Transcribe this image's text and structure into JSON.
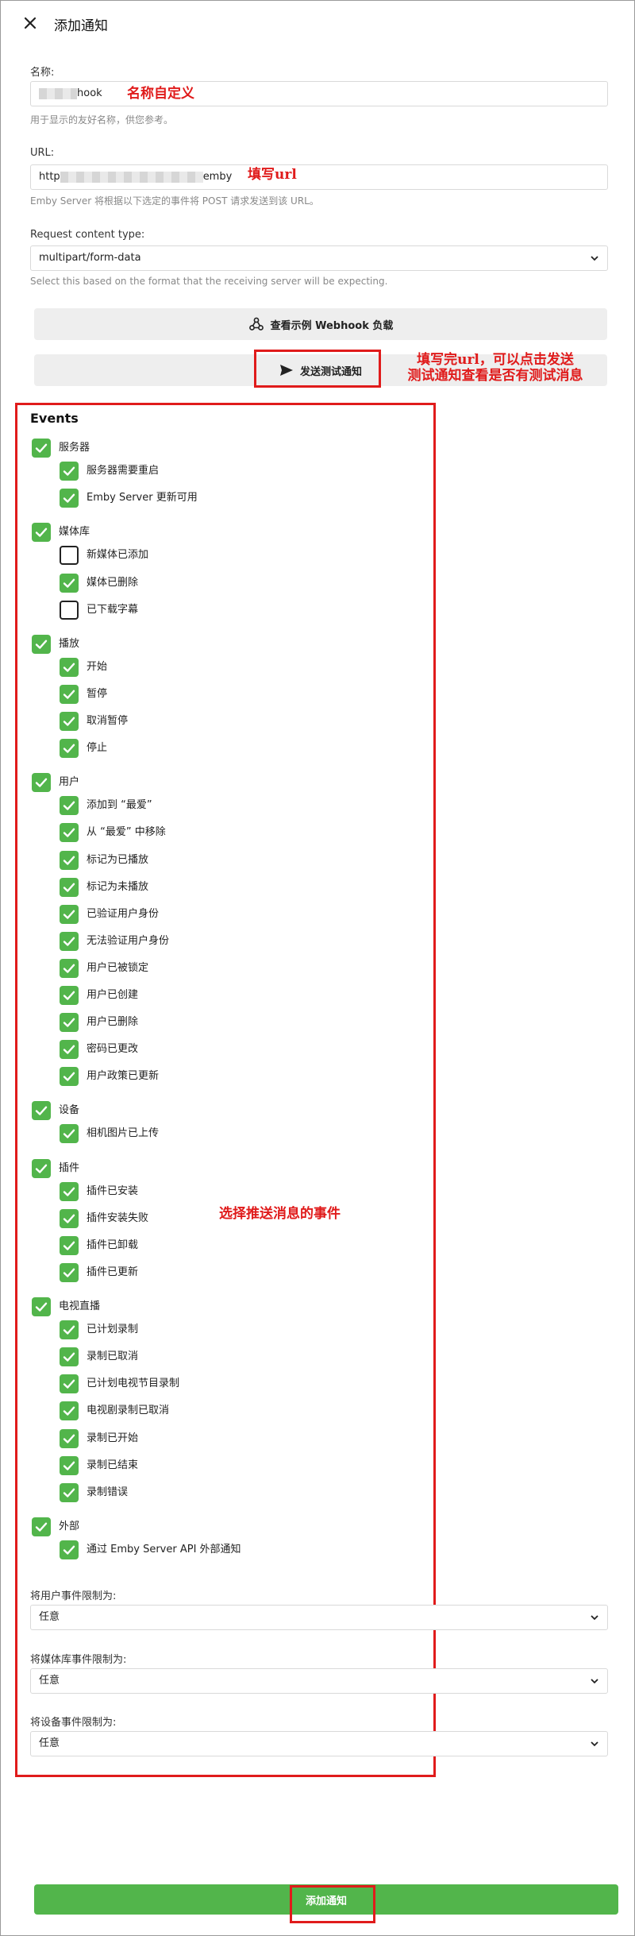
{
  "header": {
    "title": "添加通知"
  },
  "name_field": {
    "label": "名称:",
    "value_suffix": "hook",
    "hint": "用于显示的友好名称，供您参考。",
    "annotation": "名称自定义"
  },
  "url_field": {
    "label": "URL:",
    "value_prefix": "http",
    "value_suffix": "emby",
    "hint": "Emby Server 将根据以下选定的事件将 POST 请求发送到该 URL。",
    "annotation": "填写url"
  },
  "content_type": {
    "label": "Request content type:",
    "value": "multipart/form-data",
    "hint": "Select this based on the format that the receiving server will be expecting."
  },
  "buttons": {
    "sample_label": "查看示例 Webhook 负载",
    "test_label": "发送测试通知",
    "test_annotation_line1": "填写完url，可以点击发送",
    "test_annotation_line2": "测试通知查看是否有测试消息",
    "submit_label": "添加通知"
  },
  "events": {
    "heading": "Events",
    "annotation": "选择推送消息的事件",
    "groups": [
      {
        "label": "服务器",
        "checked": true,
        "items": [
          {
            "label": "服务器需要重启",
            "checked": true
          },
          {
            "label": "Emby Server 更新可用",
            "checked": true
          }
        ]
      },
      {
        "label": "媒体库",
        "checked": true,
        "items": [
          {
            "label": "新媒体已添加",
            "checked": false
          },
          {
            "label": "媒体已删除",
            "checked": true
          },
          {
            "label": "已下载字幕",
            "checked": false
          }
        ]
      },
      {
        "label": "播放",
        "checked": true,
        "items": [
          {
            "label": "开始",
            "checked": true
          },
          {
            "label": "暂停",
            "checked": true
          },
          {
            "label": "取消暂停",
            "checked": true
          },
          {
            "label": "停止",
            "checked": true
          }
        ]
      },
      {
        "label": "用户",
        "checked": true,
        "items": [
          {
            "label": "添加到 “最爱”",
            "checked": true
          },
          {
            "label": "从 “最爱” 中移除",
            "checked": true
          },
          {
            "label": "标记为已播放",
            "checked": true
          },
          {
            "label": "标记为未播放",
            "checked": true
          },
          {
            "label": "已验证用户身份",
            "checked": true
          },
          {
            "label": "无法验证用户身份",
            "checked": true
          },
          {
            "label": "用户已被锁定",
            "checked": true
          },
          {
            "label": "用户已创建",
            "checked": true
          },
          {
            "label": "用户已删除",
            "checked": true
          },
          {
            "label": "密码已更改",
            "checked": true
          },
          {
            "label": "用户政策已更新",
            "checked": true
          }
        ]
      },
      {
        "label": "设备",
        "checked": true,
        "items": [
          {
            "label": "相机图片已上传",
            "checked": true
          }
        ]
      },
      {
        "label": "插件",
        "checked": true,
        "items": [
          {
            "label": "插件已安装",
            "checked": true
          },
          {
            "label": "插件安装失败",
            "checked": true
          },
          {
            "label": "插件已卸载",
            "checked": true
          },
          {
            "label": "插件已更新",
            "checked": true
          }
        ]
      },
      {
        "label": "电视直播",
        "checked": true,
        "items": [
          {
            "label": "已计划录制",
            "checked": true
          },
          {
            "label": "录制已取消",
            "checked": true
          },
          {
            "label": "已计划电视节目录制",
            "checked": true
          },
          {
            "label": "电视剧录制已取消",
            "checked": true
          },
          {
            "label": "录制已开始",
            "checked": true
          },
          {
            "label": "录制已结束",
            "checked": true
          },
          {
            "label": "录制错误",
            "checked": true
          }
        ]
      },
      {
        "label": "外部",
        "checked": true,
        "items": [
          {
            "label": "通过 Emby Server API 外部通知",
            "checked": true
          }
        ]
      }
    ]
  },
  "limits": [
    {
      "label": "将用户事件限制为:",
      "value": "任意"
    },
    {
      "label": "将媒体库事件限制为:",
      "value": "任意"
    },
    {
      "label": "将设备事件限制为:",
      "value": "任意"
    }
  ],
  "colors": {
    "accent": "#52b54b",
    "annotation": "#e01b1b"
  }
}
